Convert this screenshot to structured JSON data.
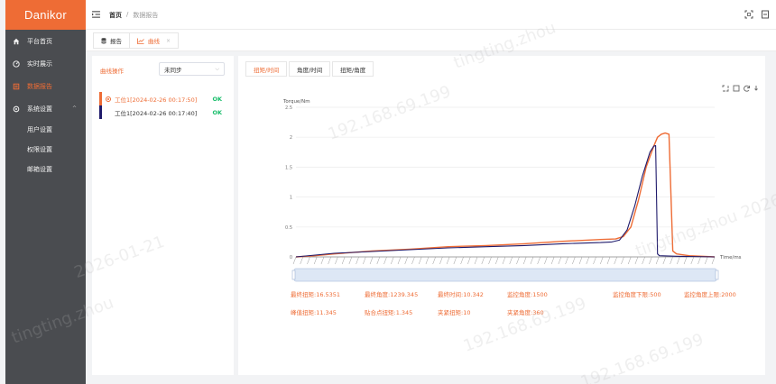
{
  "app": {
    "logo": "Danikor"
  },
  "sidebar": {
    "items": [
      {
        "label": "平台首页",
        "icon": "home-icon"
      },
      {
        "label": "实时展示",
        "icon": "dashboard-icon"
      },
      {
        "label": "数据报告",
        "icon": "report-icon",
        "active": true
      },
      {
        "label": "系统设置",
        "icon": "gear-icon"
      }
    ],
    "sub_items": [
      "用户设置",
      "权限设置",
      "邮箱设置"
    ]
  },
  "header": {
    "breadcrumb": [
      "首页",
      "/",
      "数据报告"
    ]
  },
  "tabs": [
    {
      "label": "报告",
      "icon": "stack-icon"
    },
    {
      "label": "曲线",
      "icon": "line-chart-icon",
      "active": true
    }
  ],
  "left_panel": {
    "label": "曲线操作",
    "select_value": "未同步",
    "records": [
      {
        "label": "工位1[2024-02-26 00:17:50]",
        "status": "OK",
        "color": "#ee6c35",
        "selected": true
      },
      {
        "label": "工位1[2024-02-26 00:17:40]",
        "status": "OK",
        "color": "#1f1a6b",
        "selected": false
      }
    ]
  },
  "right_panel": {
    "tabs": [
      "扭矩/时间",
      "角度/时间",
      "扭矩/角度"
    ]
  },
  "chart_data": {
    "type": "line",
    "ylabel": "Torque/Nm",
    "xlabel": "Time/ms",
    "ylim": [
      0,
      2.5
    ],
    "yticks": [
      "0",
      "0.5",
      "1",
      "1.5",
      "2",
      "2.5"
    ],
    "grid": true,
    "series": [
      {
        "color": "#ee6c35",
        "x": [
          0,
          500,
          1000,
          2000,
          3000,
          4000,
          5000,
          6000,
          7000,
          8000,
          8400,
          8600,
          8800,
          9000,
          9200,
          9400,
          9500,
          9600,
          9700,
          9800,
          9900,
          10000,
          10342,
          11000
        ],
        "y": [
          0,
          0.02,
          0.05,
          0.1,
          0.13,
          0.17,
          0.19,
          0.22,
          0.26,
          0.29,
          0.3,
          0.34,
          0.5,
          0.95,
          1.5,
          1.85,
          2.0,
          2.05,
          2.07,
          2.05,
          0.1,
          0.05,
          0.02,
          0.0
        ]
      },
      {
        "color": "#1f1a6b",
        "x": [
          0,
          500,
          1000,
          2000,
          3000,
          4000,
          5000,
          6000,
          7000,
          8000,
          8300,
          8500,
          8700,
          8900,
          9100,
          9300,
          9400,
          9450,
          9500,
          9550,
          10000,
          11000
        ],
        "y": [
          0,
          0.03,
          0.06,
          0.09,
          0.12,
          0.15,
          0.17,
          0.19,
          0.22,
          0.24,
          0.25,
          0.28,
          0.45,
          0.85,
          1.35,
          1.75,
          1.85,
          1.86,
          0.05,
          0.02,
          0.01,
          0.0
        ]
      }
    ]
  },
  "stats": {
    "row1": [
      "最终扭矩:16.5351",
      "最终角度:1239.345",
      "最终时间:10.342",
      "监控角度:1500",
      "监控角度下限:500",
      "监控角度上限:2000"
    ],
    "row2": [
      "峰值扭矩:11.345",
      "贴合点扭矩:1.345",
      "夹紧扭矩:10",
      "夹紧角度:360"
    ]
  },
  "watermarks": [
    "tingting.zhou",
    "192.168.69.199",
    "2026-01-21",
    "tingting.zhou",
    "192.168.69.199",
    "tingting.zhou 2026",
    "192.168.69.199"
  ]
}
